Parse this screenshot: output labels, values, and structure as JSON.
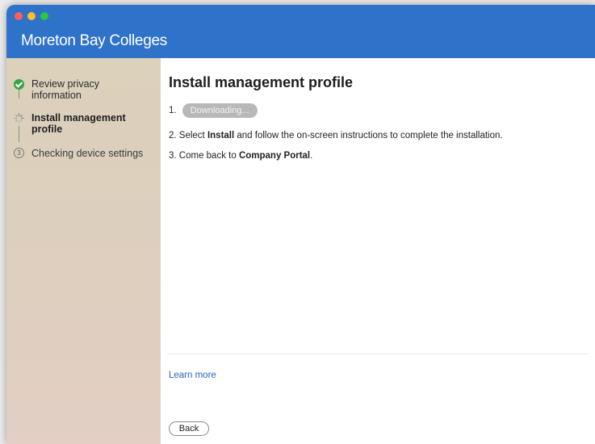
{
  "window": {
    "title": "Moreton Bay Colleges"
  },
  "sidebar": {
    "steps": [
      {
        "line1": "Review privacy",
        "line2": "information",
        "icon": "check-circle-icon",
        "state": "complete"
      },
      {
        "line1": "Install management",
        "line2": "profile",
        "icon": "spinner-icon",
        "state": "active"
      },
      {
        "line1": "Checking device settings",
        "line2": "",
        "icon": "circled-three-icon",
        "state": "upcoming",
        "number": "3"
      }
    ]
  },
  "main": {
    "title": "Install management profile",
    "steps": {
      "one_prefix": "1.",
      "download_label": "Downloading...",
      "two_prefix": "2. Select ",
      "two_bold": "Install",
      "two_suffix": " and follow the on-screen instructions to complete the installation.",
      "three_prefix": "3. Come back to ",
      "three_bold": "Company Portal",
      "three_suffix": "."
    },
    "learn_more": "Learn more",
    "back_label": "Back"
  },
  "colors": {
    "titlebar": "#2f72c9",
    "link": "#2766c4",
    "check": "#3aa34a"
  }
}
